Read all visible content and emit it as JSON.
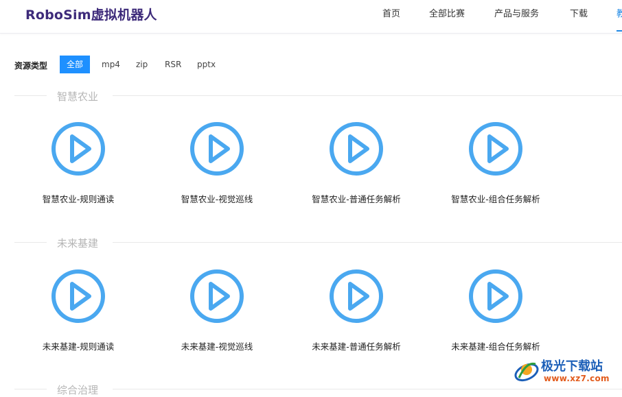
{
  "brand": "RoboSim虚拟机器人",
  "nav": [
    "首页",
    "全部比赛",
    "产品与服务",
    "下载",
    "教"
  ],
  "filter": {
    "label": "资源类型",
    "options": [
      "全部",
      "mp4",
      "zip",
      "RSR",
      "pptx"
    ],
    "active": "全部"
  },
  "sections": [
    {
      "title": "智慧农业",
      "items": [
        "智慧农业-规则通读",
        "智慧农业-视觉巡线",
        "智慧农业-普通任务解析",
        "智慧农业-组合任务解析"
      ]
    },
    {
      "title": "未来基建",
      "items": [
        "未来基建-规则通读",
        "未来基建-视觉巡线",
        "未来基建-普通任务解析",
        "未来基建-组合任务解析"
      ]
    },
    {
      "title": "综合治理",
      "items": []
    }
  ],
  "icon": "play-circle-icon",
  "colors": {
    "brand": "#3d2a7a",
    "accent": "#1e90ff",
    "play": "#4aa8f0"
  },
  "watermark": {
    "text": "极光下载站",
    "url": "www.xz7.com"
  }
}
